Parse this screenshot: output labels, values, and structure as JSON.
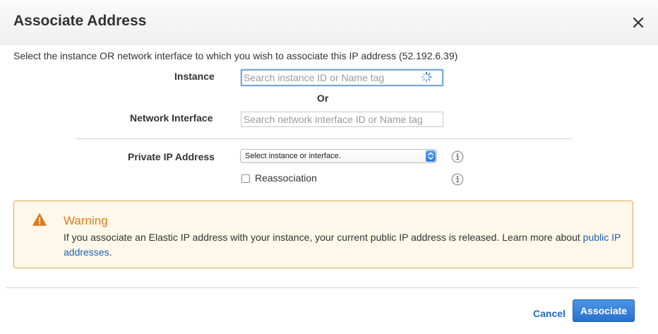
{
  "dialog": {
    "title": "Associate Address",
    "intro": "Select the instance OR network interface to which you wish to associate this IP address (52.192.6.39)"
  },
  "form": {
    "instance_label": "Instance",
    "instance_placeholder": "Search instance ID or Name tag",
    "or_label": "Or",
    "network_interface_label": "Network Interface",
    "network_interface_placeholder": "Search network interface ID or Name tag",
    "private_ip_label": "Private IP Address",
    "private_ip_selected": "Select instance or interface.",
    "reassociation_label": "Reassociation",
    "reassociation_checked": false
  },
  "warning": {
    "title": "Warning",
    "text": "If you associate an Elastic IP address with your instance, your current public IP address is released. Learn more about ",
    "link": "public IP addresses",
    "end": "."
  },
  "footer": {
    "cancel_label": "Cancel",
    "associate_label": "Associate"
  },
  "colors": {
    "accent": "#2a70cd",
    "warning_border": "#e9a44f",
    "warning_bg": "#fdf8e9",
    "warning_title": "#e07b1f",
    "link": "#1f5fb7"
  },
  "icons": [
    "close-icon",
    "loading-spinner-icon",
    "warning-icon",
    "info-icon",
    "select-arrow-icon"
  ]
}
